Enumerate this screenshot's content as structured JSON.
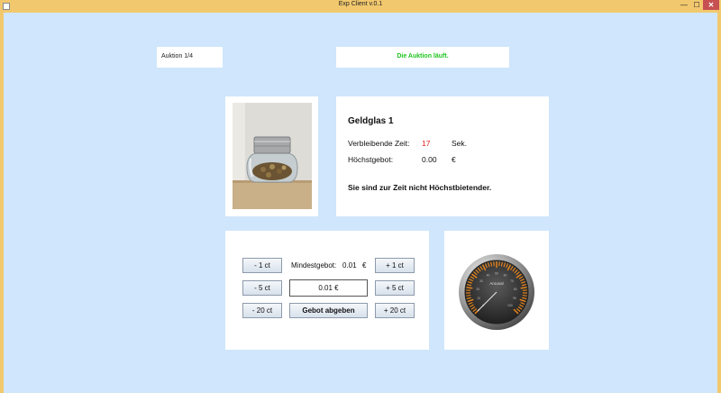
{
  "window": {
    "title": "Exp Client v.0.1",
    "minimize_glyph": "—",
    "maximize_glyph": "☐",
    "close_glyph": "✕"
  },
  "auction": {
    "label": "Auktion 1/4"
  },
  "status": {
    "text": "Die Auktion läuft.",
    "color": "#22c422"
  },
  "item": {
    "name": "Geldglas 1",
    "time_label": "Verbleibende Zeit:",
    "time_value": "17",
    "time_unit": "Sek.",
    "highest_bid_label": "Höchstgebot:",
    "highest_bid_value": "0.00",
    "currency": "€",
    "bidder_status": "Sie sind zur Zeit nicht Höchstbietender."
  },
  "bid_panel": {
    "minus_1": "- 1 ct",
    "minus_5": "- 5 ct",
    "minus_20": "- 20 ct",
    "plus_1": "+ 1 ct",
    "plus_5": "+ 5 ct",
    "plus_20": "+ 20 ct",
    "min_bid_label": "Mindestgebot:",
    "min_bid_value": "0.01",
    "min_bid_unit": "€",
    "bid_input_value": "0.01 €",
    "submit_label": "Gebot abgeben"
  },
  "gauge": {
    "label": "Arousal",
    "ticks": [
      "0",
      "10",
      "20",
      "30",
      "40",
      "50",
      "60",
      "70",
      "80",
      "90",
      "100"
    ],
    "value": 0,
    "accent_color": "#f08a1c"
  }
}
